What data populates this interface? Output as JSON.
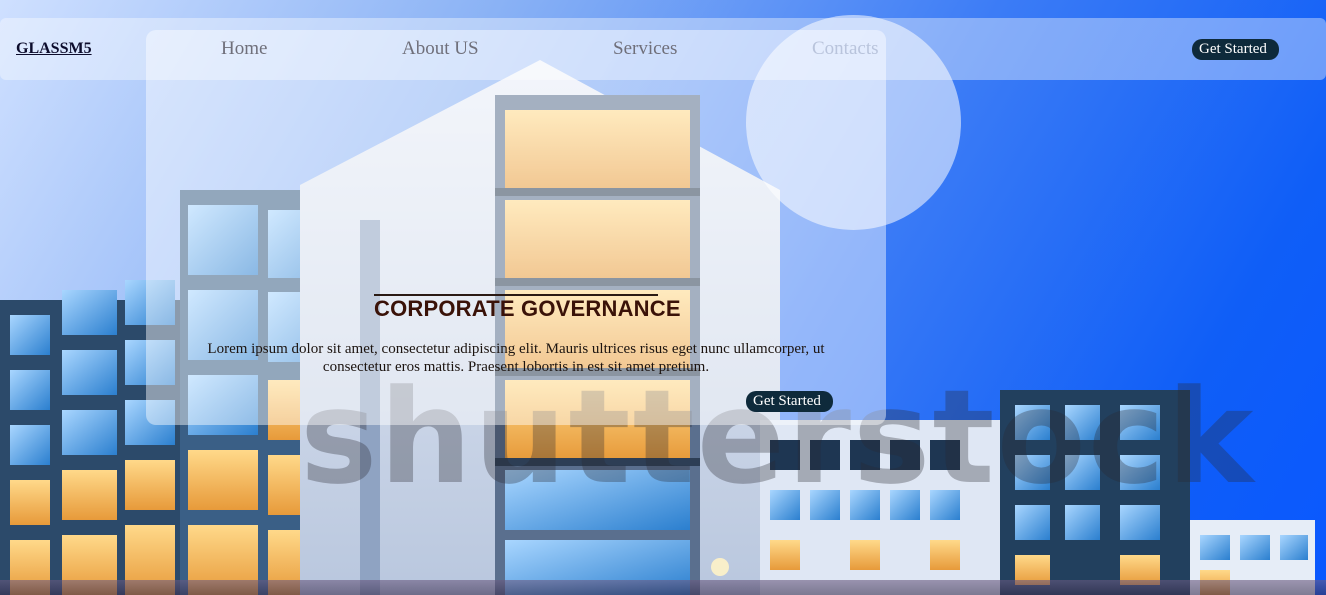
{
  "navbar": {
    "brand": "GLASSM5",
    "links": [
      "Home",
      "About US",
      "Services",
      "Contacts"
    ],
    "cta_label": "Get Started"
  },
  "hero": {
    "title": "CORPORATE GOVERNANCE",
    "body": "Lorem ipsum dolor sit amet, consectetur adipiscing elit. Mauris ultrices risus eget nunc ullamcorper, ut consectetur eros mattis. Praesent lobortis in est sit amet pretium.",
    "cta_label": "Get Started"
  },
  "background": {
    "watermark": "shutterstock"
  },
  "colors": {
    "button": "#0e2a3b",
    "title": "#3a1208",
    "sky": "#0a58ff"
  }
}
